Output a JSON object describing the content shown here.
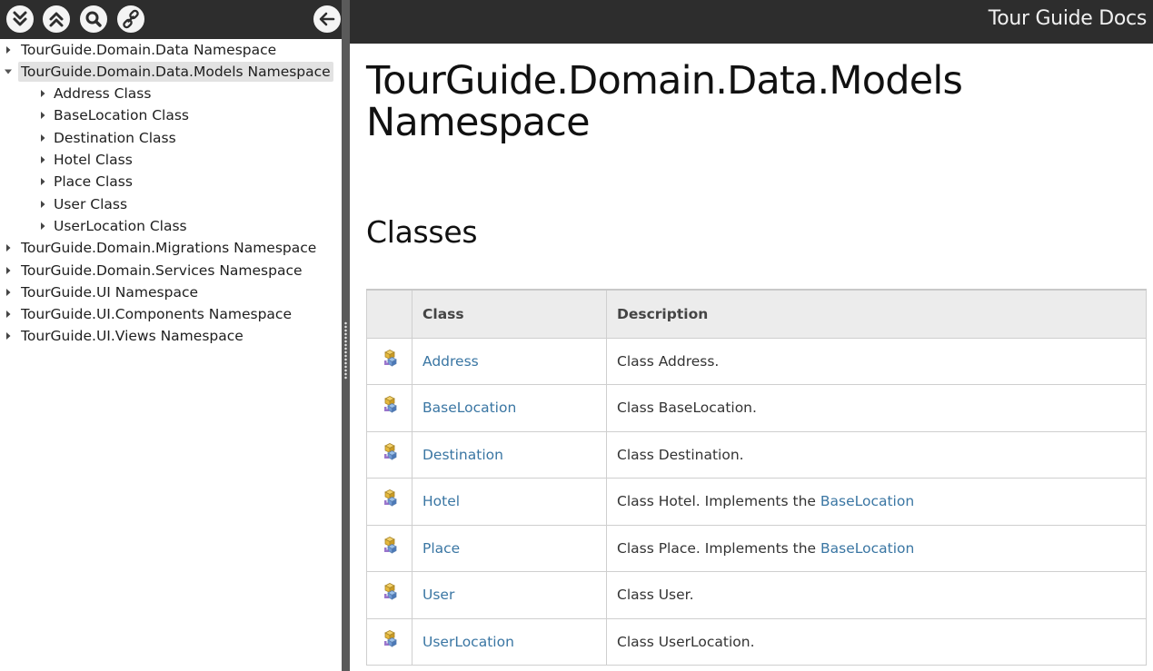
{
  "site_title": "Tour Guide Docs",
  "toolbar": {
    "expand_icon": "expand-all-icon",
    "collapse_icon": "collapse-all-icon",
    "search_icon": "search-icon",
    "link_icon": "link-icon",
    "back_icon": "arrow-left-icon"
  },
  "tree": [
    {
      "label": "TourGuide.Domain.Data Namespace",
      "level": 0,
      "expanded": false,
      "selected": false
    },
    {
      "label": "TourGuide.Domain.Data.Models Namespace",
      "level": 0,
      "expanded": true,
      "selected": true
    },
    {
      "label": "Address Class",
      "level": 1,
      "expanded": false,
      "selected": false
    },
    {
      "label": "BaseLocation Class",
      "level": 1,
      "expanded": false,
      "selected": false
    },
    {
      "label": "Destination Class",
      "level": 1,
      "expanded": false,
      "selected": false
    },
    {
      "label": "Hotel Class",
      "level": 1,
      "expanded": false,
      "selected": false
    },
    {
      "label": "Place Class",
      "level": 1,
      "expanded": false,
      "selected": false
    },
    {
      "label": "User Class",
      "level": 1,
      "expanded": false,
      "selected": false
    },
    {
      "label": "UserLocation Class",
      "level": 1,
      "expanded": false,
      "selected": false
    },
    {
      "label": "TourGuide.Domain.Migrations Namespace",
      "level": 0,
      "expanded": false,
      "selected": false
    },
    {
      "label": "TourGuide.Domain.Services Namespace",
      "level": 0,
      "expanded": false,
      "selected": false
    },
    {
      "label": "TourGuide.UI Namespace",
      "level": 0,
      "expanded": false,
      "selected": false
    },
    {
      "label": "TourGuide.UI.Components Namespace",
      "level": 0,
      "expanded": false,
      "selected": false
    },
    {
      "label": "TourGuide.UI.Views Namespace",
      "level": 0,
      "expanded": false,
      "selected": false
    }
  ],
  "page": {
    "title_line1": "TourGuide.Domain.Data.Models",
    "title_line2": "Namespace",
    "section_title": "Classes"
  },
  "table": {
    "headers": [
      "",
      "Class",
      "Description"
    ],
    "rows": [
      {
        "icon": "public-class-icon",
        "name": "Address",
        "description": "Class Address.",
        "link": ""
      },
      {
        "icon": "public-class-icon",
        "name": "BaseLocation",
        "description": "Class BaseLocation.",
        "link": ""
      },
      {
        "icon": "public-class-icon",
        "name": "Destination",
        "description": "Class Destination.",
        "link": ""
      },
      {
        "icon": "public-class-icon",
        "name": "Hotel",
        "description": "Class Hotel. Implements the ",
        "link": "BaseLocation"
      },
      {
        "icon": "public-class-icon",
        "name": "Place",
        "description": "Class Place. Implements the ",
        "link": "BaseLocation"
      },
      {
        "icon": "public-class-icon",
        "name": "User",
        "description": "Class User.",
        "link": ""
      },
      {
        "icon": "public-class-icon",
        "name": "UserLocation",
        "description": "Class UserLocation.",
        "link": ""
      }
    ]
  },
  "colors": {
    "header_bg": "#2d2d2d",
    "link": "#3a76a3",
    "table_header_bg": "#ececec",
    "selected_bg": "#e2e2e2"
  }
}
